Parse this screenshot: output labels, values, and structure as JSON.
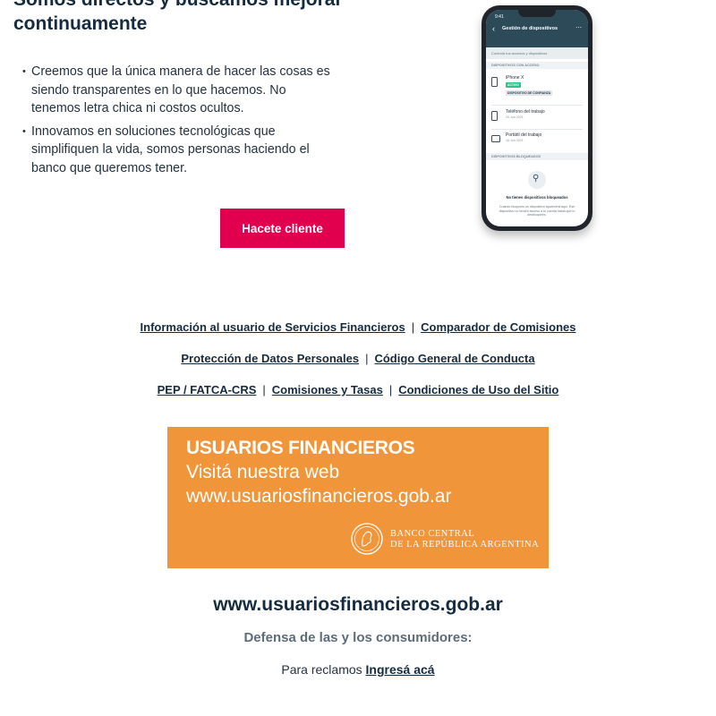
{
  "hero": {
    "title": "Somos directos y buscamos mejorar continuamente",
    "bullets": [
      "Creemos que la única manera de hacer las cosas es siendo transparentes en lo que hacemos. No tenemos letra chica ni costos ocultos.",
      "Innovamos en soluciones tecnológicas que simplifiquen la vida, somos personas haciendo el banco que queremos tener."
    ],
    "cta_label": "Hacete cliente"
  },
  "phone": {
    "time": "9:41",
    "back_icon": "chevron-left-icon",
    "title": "Gestión de dispositivos",
    "more_icon": "more-icon",
    "subtitle": "Controlá tus accesos y dispositivos",
    "section_access": "DISPOSITIVOS CON ACCESO",
    "devices": [
      {
        "name": "iPhone X",
        "badge": "ACTIVO",
        "badge2": "DISPOSITIVO DE CONFIANZA"
      },
      {
        "name": "Teléfono del trabajo",
        "date": "20 Jun 2021"
      },
      {
        "name": "Portátil del trabajo",
        "date": "16 Jun 2021"
      }
    ],
    "section_blocked": "DISPOSITIVOS BLOQUEADOS",
    "empty_title": "No tienes dispositivos bloqueados",
    "empty_text": "Cuando bloquees un dispositivo aparecerá aquí. Ese dispositivo no tendrá acceso a tu cuenta hasta que lo desbloquees."
  },
  "links": {
    "row1": [
      "Información al usuario de Servicios Financieros",
      "Comparador de Comisiones"
    ],
    "row2": [
      "Protección de Datos Personales",
      "Código General de Conducta"
    ],
    "row3": [
      "PEP / FATCA-CRS",
      "Comisiones y Tasas",
      "Condiciones de Uso del Sitio"
    ],
    "separator": "|"
  },
  "banner": {
    "line1": "USUARIOS FINANCIEROS",
    "line2": "Visitá nuestra web",
    "line3": "www.usuariosfinancieros.gob.ar",
    "org_line1": "BANCO CENTRAL",
    "org_line2": "DE LA REPÚBLICA ARGENTINA",
    "seal_icon": "bcra-seal-icon",
    "color": "#f0953a"
  },
  "footer": {
    "site_url": "www.usuariosfinancieros.gob.ar",
    "defensa": "Defensa de las y los consumidores:",
    "reclamos_prefix": "Para reclamos ",
    "reclamos_link": "Ingresá acá"
  },
  "colors": {
    "accent": "#e0004d",
    "text": "#152b3f"
  }
}
